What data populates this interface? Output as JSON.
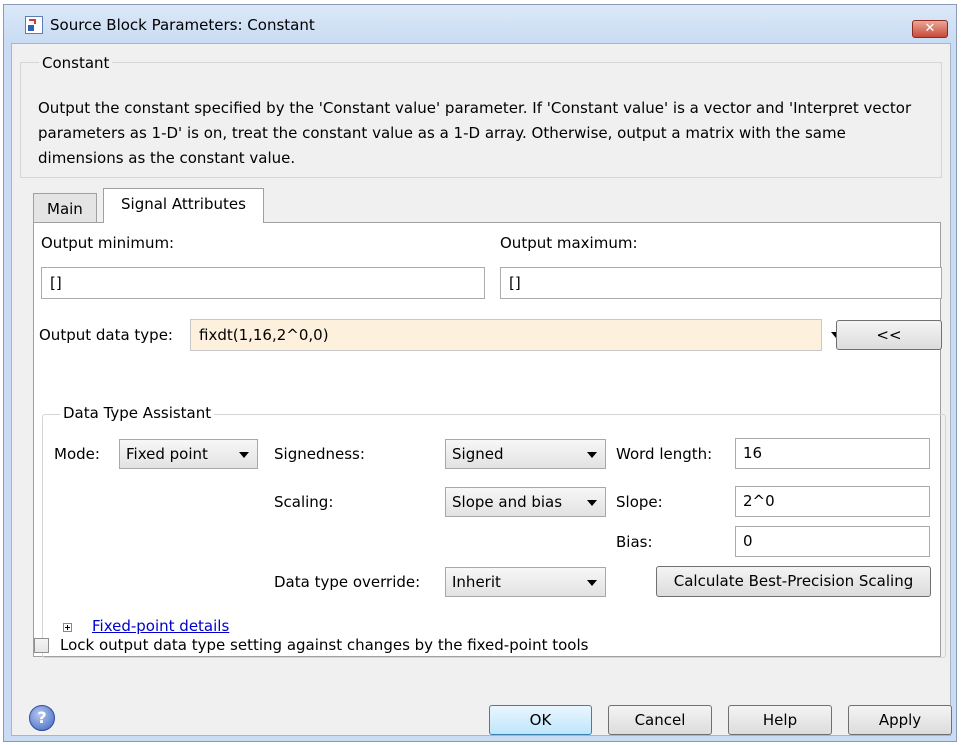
{
  "window": {
    "title": "Source Block Parameters: Constant",
    "close_label": "✕"
  },
  "description": {
    "legend": "Constant",
    "text": "Output the constant specified by the 'Constant value' parameter. If 'Constant value' is a vector and 'Interpret vector parameters as 1-D' is on, treat the constant value as a 1-D array. Otherwise, output a matrix with the same dimensions as the constant value."
  },
  "tabs": [
    {
      "label": "Main",
      "active": false
    },
    {
      "label": "Signal Attributes",
      "active": true
    }
  ],
  "signal_attributes": {
    "output_minimum_label": "Output minimum:",
    "output_minimum_value": "[]",
    "output_maximum_label": "Output maximum:",
    "output_maximum_value": "[]",
    "output_data_type_label": "Output data type:",
    "output_data_type_value": "fixdt(1,16,2^0,0)",
    "assistant_toggle_label": "<<"
  },
  "assistant": {
    "legend": "Data Type Assistant",
    "mode_label": "Mode:",
    "mode_value": "Fixed point",
    "signedness_label": "Signedness:",
    "signedness_value": "Signed",
    "word_length_label": "Word length:",
    "word_length_value": "16",
    "scaling_label": "Scaling:",
    "scaling_value": "Slope and bias",
    "slope_label": "Slope:",
    "slope_value": "2^0",
    "bias_label": "Bias:",
    "bias_value": "0",
    "override_label": "Data type override:",
    "override_value": "Inherit",
    "calc_button": "Calculate Best-Precision Scaling",
    "details_link": "Fixed-point details"
  },
  "lock_checkbox": {
    "label": "Lock output data type setting against changes by the fixed-point tools",
    "checked": false
  },
  "buttons": {
    "ok": "OK",
    "cancel": "Cancel",
    "help": "Help",
    "apply": "Apply"
  },
  "colors": {
    "data_type_field_bg": "#fdf0dc",
    "link": "#0000cc"
  },
  "icons": {
    "app": "simulink-block-icon",
    "close": "close-icon",
    "help": "help-icon"
  }
}
